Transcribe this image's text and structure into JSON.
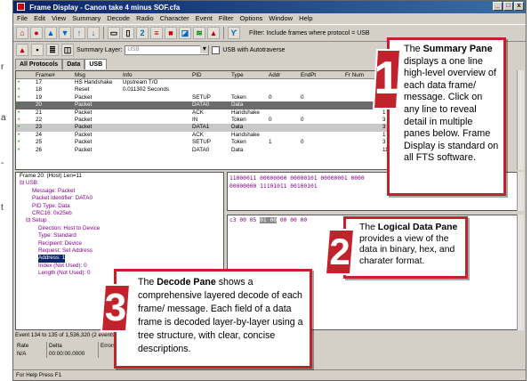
{
  "window": {
    "title": "Frame Display - Canon take 4 minus SOF.cfa",
    "controls": [
      "_",
      "□",
      "x"
    ]
  },
  "menu": [
    "File",
    "Edit",
    "View",
    "Summary",
    "Decode",
    "Radio",
    "Character",
    "Event",
    "Filter",
    "Options",
    "Window",
    "Help"
  ],
  "toolbar": {
    "filter_text": "Filter:  Include frames where protocol = USB",
    "buttons": [
      {
        "icon": "home-icon",
        "glyph": "⌂",
        "color": "red"
      },
      {
        "icon": "capture-icon",
        "glyph": "●",
        "color": "red"
      },
      {
        "icon": "first-icon",
        "glyph": "▲",
        "color": "blue"
      },
      {
        "icon": "prev-icon",
        "glyph": "▼",
        "color": "blue"
      },
      {
        "icon": "next-icon",
        "glyph": "↑",
        "color": "blue"
      },
      {
        "icon": "last-icon",
        "glyph": "↓",
        "color": "blue"
      },
      {
        "icon": "page-icon",
        "glyph": "▭",
        "color": ""
      },
      {
        "icon": "copy-icon",
        "glyph": "▯",
        "color": ""
      },
      {
        "icon": "panes-icon",
        "glyph": "2",
        "color": "blue"
      },
      {
        "icon": "bookmark-icon",
        "glyph": "≡",
        "color": "red"
      },
      {
        "icon": "binary-icon",
        "glyph": "■",
        "color": "red"
      },
      {
        "icon": "decode-icon",
        "glyph": "◪",
        "color": "blue"
      },
      {
        "icon": "stats-icon",
        "glyph": "≋",
        "color": "green"
      },
      {
        "icon": "event-icon",
        "glyph": "▴",
        "color": "red"
      },
      {
        "icon": "filter-icon",
        "glyph": "ϒ",
        "color": "blue"
      }
    ]
  },
  "summary_toolbar": {
    "layer_label": "Summary Layer:",
    "layer_value": "USB",
    "autotraverse_label": "USB with Autotraverse"
  },
  "tabs": [
    "All Protocols",
    "Data",
    "USB"
  ],
  "summary_table": {
    "columns": [
      "",
      "Frame#",
      "Msg",
      "Info",
      "PID",
      "Type",
      "Addr",
      "EndPt",
      "Fr Num",
      ""
    ],
    "rows": [
      {
        "marker": "•",
        "frame": "17",
        "msg": "HS Handshake",
        "info": "Upstream T/O",
        "pid": "",
        "type": "",
        "addr": "",
        "endpt": "",
        "frnum": "",
        "extra": "",
        "style": ""
      },
      {
        "marker": "•",
        "frame": "18",
        "msg": "Reset",
        "info": "0.011302 Seconds",
        "pid": "",
        "type": "",
        "addr": "",
        "endpt": "",
        "frnum": "",
        "extra": "",
        "style": ""
      },
      {
        "marker": "•",
        "frame": "19",
        "msg": "Packet",
        "info": "",
        "pid": "SETUP",
        "type": "Token",
        "addr": "0",
        "endpt": "0",
        "frnum": "",
        "extra": "",
        "style": ""
      },
      {
        "marker": "•",
        "frame": "20",
        "msg": "Packet",
        "info": "",
        "pid": "DATA0",
        "type": "Data",
        "addr": "",
        "endpt": "",
        "frnum": "",
        "extra": "",
        "style": "dark"
      },
      {
        "marker": "•",
        "frame": "21",
        "msg": "Packet",
        "info": "",
        "pid": "ACK",
        "type": "Handshake",
        "addr": "",
        "endpt": "",
        "frnum": "",
        "extra": "1",
        "style": ""
      },
      {
        "marker": "•",
        "frame": "22",
        "msg": "Packet",
        "info": "",
        "pid": "IN",
        "type": "Token",
        "addr": "0",
        "endpt": "0",
        "frnum": "",
        "extra": "3",
        "style": ""
      },
      {
        "marker": "•",
        "frame": "23",
        "msg": "Packet",
        "info": "",
        "pid": "DATA1",
        "type": "Data",
        "addr": "",
        "endpt": "",
        "frnum": "",
        "extra": "3",
        "style": "light"
      },
      {
        "marker": "•",
        "frame": "24",
        "msg": "Packet",
        "info": "",
        "pid": "ACK",
        "type": "Handshake",
        "addr": "",
        "endpt": "",
        "frnum": "",
        "extra": "1",
        "style": ""
      },
      {
        "marker": "•",
        "frame": "25",
        "msg": "Packet",
        "info": "",
        "pid": "SETUP",
        "type": "Token",
        "addr": "1",
        "endpt": "0",
        "frnum": "",
        "extra": "3",
        "style": ""
      },
      {
        "marker": "•",
        "frame": "26",
        "msg": "Packet",
        "info": "",
        "pid": "DATA0",
        "type": "Data",
        "addr": "",
        "endpt": "",
        "frnum": "",
        "extra": "11",
        "style": ""
      }
    ]
  },
  "decode_tree": [
    {
      "text": "Frame 20: (Host) Len=11",
      "color": "black",
      "indent": 0
    },
    {
      "text": "⊟ USB:",
      "color": "purple",
      "indent": 0
    },
    {
      "text": "Message: Packet",
      "color": "purple",
      "indent": 2
    },
    {
      "text": "Packet Identifier: DATA0",
      "color": "purple",
      "indent": 2
    },
    {
      "text": "PID Type: Data",
      "color": "purple",
      "indent": 2
    },
    {
      "text": "CRC16: 0x25eb",
      "color": "purple",
      "indent": 2
    },
    {
      "text": "⊟ Setup",
      "color": "purple",
      "indent": 1
    },
    {
      "text": "Direction: Host to Device",
      "color": "purple",
      "indent": 3
    },
    {
      "text": "Type: Standard",
      "color": "purple",
      "indent": 3
    },
    {
      "text": "Recipient: Device",
      "color": "purple",
      "indent": 3
    },
    {
      "text": "Request: Set Address",
      "color": "purple",
      "indent": 3
    },
    {
      "text": "Address: 1",
      "color": "selected",
      "indent": 3
    },
    {
      "text": "Index (Not Used): 0",
      "color": "purple",
      "indent": 3
    },
    {
      "text": "Length (Not Used): 0",
      "color": "purple",
      "indent": 3
    }
  ],
  "binary_pane": {
    "line1": "11000011 00000000 00000101 00000001 0000",
    "line2": "00000000 11101011 00100101"
  },
  "hex_pane": {
    "before": "c3 00 05 ",
    "highlight": "01 00",
    "after": " 00 00 00"
  },
  "status": {
    "events": "Event 134 to 135 of 1,536,320 (2 events)",
    "stats_headers": [
      "Rate",
      "Delta",
      "Errors"
    ],
    "stats_values": [
      "N/A",
      "00:00:00.0000",
      ""
    ],
    "help": "For Help Press F1"
  },
  "edge_chars": [
    "r",
    "a",
    "-",
    "t"
  ],
  "callouts": {
    "one": {
      "number": "1",
      "prefix": "The ",
      "title": "Summary Pane",
      "body": " displays a one line high-level overview of each data frame/ message. Click on any line to reveal detail in multiple panes below. Frame Display is standard on all FTS software."
    },
    "two": {
      "number": "2",
      "prefix": "The ",
      "title": "Logical Data Pane",
      "body": " provides a view of the data in binary, hex, and charater format."
    },
    "three": {
      "number": "3",
      "prefix": "The ",
      "title": "Decode Pane",
      "body": " shows a comprehensive layered decode of each frame/ message. Each field of a data frame is decoded layer-by-layer using a tree structure, with clear, concise descriptions."
    }
  },
  "colors": {
    "callout_border": "#c0232b",
    "badge_red": "#c0232b",
    "title_bar": "#0a246a",
    "decode_text": "#800080"
  }
}
